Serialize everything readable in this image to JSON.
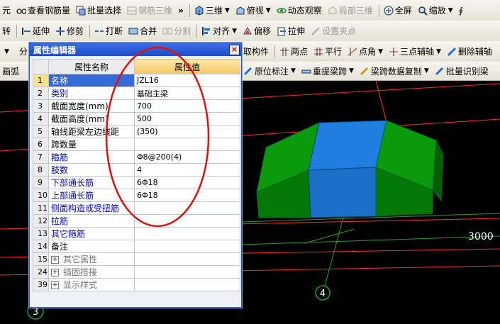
{
  "toolbar1": {
    "items": [
      "元",
      "查看钢筋量",
      "批量选择",
      "钢筋三维",
      "»",
      "三维",
      "俯视",
      "动态观察",
      "局部三维",
      "全屏",
      "缩放",
      "∮"
    ]
  },
  "toolbar2": {
    "items": [
      "转",
      "延伸",
      "修剪",
      "打断",
      "合并",
      "分割",
      "对齐",
      "偏移",
      "拉伸",
      "设置夹点"
    ]
  },
  "toolbar3": {
    "items": [
      "分",
      "取构件",
      "两点",
      "平行",
      "点角",
      "三点辅轴",
      "删除辅轴"
    ]
  },
  "toolbar4": {
    "items": [
      "画弧",
      "原位标注",
      "重提梁跨",
      "梁跨数据复制",
      "批量识别梁"
    ]
  },
  "dialog": {
    "title": "属性编辑器",
    "close": "×",
    "col_name": "属性名称",
    "col_value": "属性值",
    "rows": [
      {
        "num": "1",
        "name": "名称",
        "value": "JZL16"
      },
      {
        "num": "2",
        "name": "类别",
        "value": "基础主梁"
      },
      {
        "num": "3",
        "name": "截面宽度(mm)",
        "value": "700"
      },
      {
        "num": "4",
        "name": "截面高度(mm)",
        "value": "500"
      },
      {
        "num": "5",
        "name": "轴线距梁左边线距",
        "value": "(350)"
      },
      {
        "num": "6",
        "name": "跨数量",
        "value": ""
      },
      {
        "num": "7",
        "name": "箍筋",
        "value": "Φ8@200(4)"
      },
      {
        "num": "8",
        "name": "肢数",
        "value": "4"
      },
      {
        "num": "9",
        "name": "下部通长筋",
        "value": "6Φ18"
      },
      {
        "num": "10",
        "name": "上部通长筋",
        "value": "6Φ18"
      },
      {
        "num": "11",
        "name": "侧面构造或受扭筋",
        "value": ""
      },
      {
        "num": "12",
        "name": "拉筋",
        "value": ""
      },
      {
        "num": "13",
        "name": "其它箍筋",
        "value": ""
      },
      {
        "num": "14",
        "name": "备注",
        "value": ""
      },
      {
        "num": "15",
        "name": "其它属性",
        "value": ""
      },
      {
        "num": "24",
        "name": "锚固搭接",
        "value": ""
      },
      {
        "num": "39",
        "name": "显示样式",
        "value": ""
      }
    ]
  },
  "scene": {
    "dimension_label": "3000",
    "axis_label_4": "4",
    "axis_label_3": "3",
    "colors": {
      "beam_green": "#0a8a0a",
      "beam_blue": "#1f7fe0",
      "grid_red": "#ff2a2a",
      "annotation_red": "#e01010"
    }
  }
}
